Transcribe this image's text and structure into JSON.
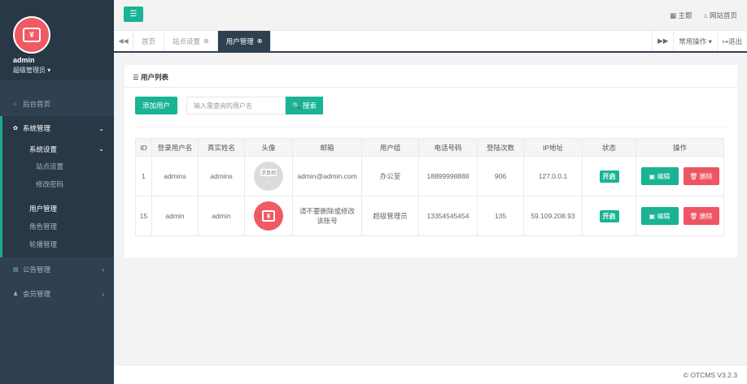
{
  "sidebar": {
    "username": "admin",
    "role": "超级管理员 ▾",
    "items": [
      {
        "icon": "⌂",
        "label": "后台首页"
      },
      {
        "icon": "✿",
        "label": "系统管理",
        "arrow": "⌄"
      },
      {
        "icon": "▤",
        "label": "公告管理",
        "arrow": "‹"
      },
      {
        "icon": "♟",
        "label": "会员管理",
        "arrow": "‹"
      }
    ],
    "system": {
      "settings_label": "系统设置",
      "settings_arrow": "⌄",
      "site_settings": "站点设置",
      "change_password": "修改密码",
      "user_mgmt": "用户管理",
      "role_mgmt": "角色管理",
      "carousel_mgmt": "轮播管理"
    }
  },
  "topbar": {
    "theme_label": "▦ 主题",
    "site_home_label": "⌂ 网站首页"
  },
  "tabs": {
    "prev": "◀◀",
    "next": "▶▶",
    "items": [
      {
        "label": "首页",
        "close": ""
      },
      {
        "label": "站点设置",
        "close": "⊗"
      },
      {
        "label": "用户管理",
        "close": "⊗"
      }
    ],
    "common_ops": "常用操作 ▾",
    "logout": "↦退出"
  },
  "panel": {
    "title": "☰ 用户列表",
    "add_button": "添加用户",
    "search_placeholder": "输入需查询的用户名",
    "search_button": "🔍 搜索"
  },
  "table": {
    "headers": [
      "ID",
      "登录用户名",
      "真实姓名",
      "头像",
      "邮箱",
      "用户组",
      "电话号码",
      "登陆次数",
      "IP地址",
      "状态",
      "操作"
    ],
    "rows": [
      {
        "id": "1",
        "login": "admins",
        "realname": "admins",
        "avatar_tag": "求真相",
        "email": "admin@admin.com",
        "group": "办公室",
        "phone": "18899998888",
        "count": "906",
        "ip": "127.0.0.1",
        "status": "开启",
        "edit": "编辑",
        "delete": "删除"
      },
      {
        "id": "15",
        "login": "admin",
        "realname": "admin",
        "avatar_tag": "",
        "email": "请不要删除或修改该账号",
        "group": "超级管理员",
        "phone": "13354545454",
        "count": "135",
        "ip": "59.109.208.93",
        "status": "开启",
        "edit": "编辑",
        "delete": "删除"
      }
    ]
  },
  "footer": {
    "version": "© OTCMS V3.2.3"
  },
  "colors": {
    "sidebar": "#2f4050",
    "accent": "#1ab394",
    "danger": "#ed5565",
    "avatar_red": "#f05a63"
  }
}
